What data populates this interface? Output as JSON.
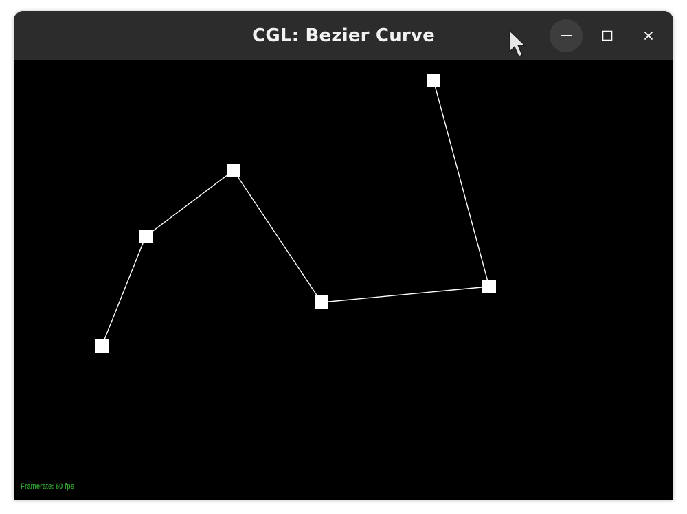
{
  "window": {
    "title": "CGL: Bezier Curve",
    "buttons": {
      "minimize_icon": "minimize-icon",
      "maximize_icon": "maximize-icon",
      "close_icon": "close-icon"
    }
  },
  "canvas": {
    "background": "#000000",
    "control_point_color": "#ffffff",
    "line_color": "#ffffff",
    "framerate_text": "Framerate: 60 fps",
    "framerate_color": "#2fa02f"
  },
  "colors": {
    "titlebar": "#2c2c2c",
    "title_text": "#f2f2f2",
    "minimize_hover_bg": "#3d3d3d"
  }
}
